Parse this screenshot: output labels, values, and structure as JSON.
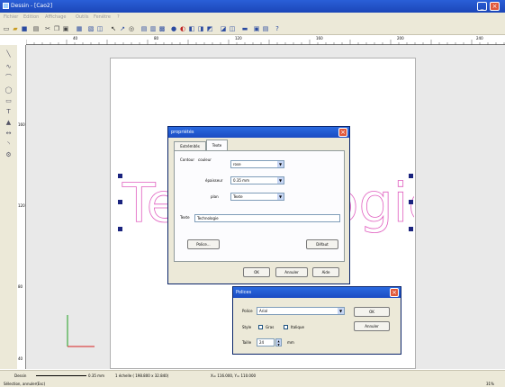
{
  "app": {
    "title": "Dessin - [Cao2]"
  },
  "menu": [
    "Fichier",
    "Edition",
    "Affichage",
    "Outils",
    "Fenêtre",
    "?"
  ],
  "ruler": {
    "h_ticks": [
      "40",
      "80",
      "120",
      "160",
      "200",
      "240"
    ],
    "v_ticks": [
      "160",
      "120",
      "80",
      "40"
    ]
  },
  "canvas": {
    "text_object": "Technologie"
  },
  "properties": {
    "title": "propriétés",
    "tabs": [
      "Extrémités",
      "Texte"
    ],
    "contour_label": "Contour",
    "couleur_label": "couleur",
    "couleur_value": "rose",
    "epaisseur_label": "épaisseur",
    "epaisseur_value": "0.35 mm",
    "plan_label": "plan",
    "plan_value": "Texte",
    "texte_label": "Texte",
    "texte_value": "Technologie",
    "police_button": "Police...",
    "defaut_button": "Défaut",
    "ok_button": "OK",
    "annuler_button": "Annuler",
    "aide_button": "Aide"
  },
  "polices": {
    "title": "Polices",
    "police_label": "Police",
    "police_value": "Arial",
    "style_label": "Style",
    "gras_label": "Gras",
    "italique_label": "Italique",
    "taille_label": "Taille",
    "taille_value": "24",
    "unit": "mm",
    "ok_button": "OK",
    "annuler_button": "Annuler"
  },
  "status": {
    "layer": "Dessin",
    "thickness": "0.35 mm",
    "scale": "1 échelle ( 198.800 x 32.840)",
    "coords": "X= 116.000, Y= 110.000",
    "hint": "Sélection, annuler(Esc)",
    "zoom": "31%"
  },
  "colors": {
    "accent": "#1b46b8",
    "text_stroke": "#e060c0",
    "axis_red": "#d82020",
    "axis_green": "#20a020"
  }
}
